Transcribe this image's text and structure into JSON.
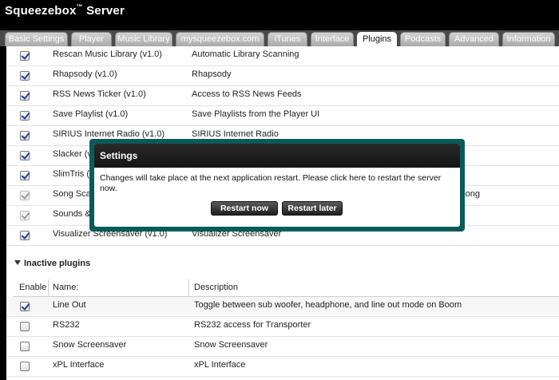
{
  "app": {
    "title": "Squeezebox",
    "title_mark": "™",
    "title_suffix": " Server"
  },
  "tabs": [
    {
      "label": "Basic Settings",
      "active": false
    },
    {
      "label": "Player",
      "active": false
    },
    {
      "label": "Music Library",
      "active": false
    },
    {
      "label": "mysqueezebox.com",
      "active": false
    },
    {
      "label": "iTunes",
      "active": false
    },
    {
      "label": "Interface",
      "active": false
    },
    {
      "label": "Plugins",
      "active": true
    },
    {
      "label": "Podcasts",
      "active": false
    },
    {
      "label": "Advanced",
      "active": false
    },
    {
      "label": "Information",
      "active": false
    }
  ],
  "active_plugins": [
    {
      "name": "Rescan Music Library (v1.0)",
      "description": "Automatic Library Scanning",
      "checked": true,
      "disabled": false
    },
    {
      "name": "Rhapsody (v1.0)",
      "description": "Rhapsody",
      "checked": true,
      "disabled": false
    },
    {
      "name": "RSS News Ticker (v1.0)",
      "description": "Access to RSS News Feeds",
      "checked": true,
      "disabled": false
    },
    {
      "name": "Save Playlist (v1.0)",
      "description": "Save Playlists from the Player UI",
      "checked": true,
      "disabled": false
    },
    {
      "name": "SIRIUS Internet Radio (v1.0)",
      "description": "SIRIUS Internet Radio",
      "checked": true,
      "disabled": false
    },
    {
      "name": "Slacker (v",
      "description": "",
      "checked": true,
      "disabled": false
    },
    {
      "name": "SlimTris (v",
      "description": "",
      "checked": true,
      "disabled": false
    },
    {
      "name": "Song Scan",
      "description": "g song",
      "checked": true,
      "disabled": true
    },
    {
      "name": "Sounds &",
      "description": "",
      "checked": true,
      "disabled": true
    },
    {
      "name": "Visualizer Screensaver (v1.0)",
      "description": "Visualizer Screensaver",
      "checked": true,
      "disabled": false
    }
  ],
  "inactive_section": {
    "title": "Inactive plugins"
  },
  "table_header": {
    "enable": "Enable",
    "name": "Name:",
    "description": "Description"
  },
  "inactive_plugins": [
    {
      "name": "Line Out",
      "description": "Toggle between sub woofer, headphone, and line out mode on Boom",
      "checked": true
    },
    {
      "name": "RS232",
      "description": "RS232 access for Transporter",
      "checked": false
    },
    {
      "name": "Snow Screensaver",
      "description": "Snow Screensaver",
      "checked": false
    },
    {
      "name": "xPL Interface",
      "description": "xPL Interface",
      "checked": false
    }
  ],
  "modal": {
    "title": "Settings",
    "message": "Changes will take place at the next application restart. Please click here to restart the server now.",
    "restart_now_label": "Restart now",
    "restart_later_label": "Restart later"
  }
}
